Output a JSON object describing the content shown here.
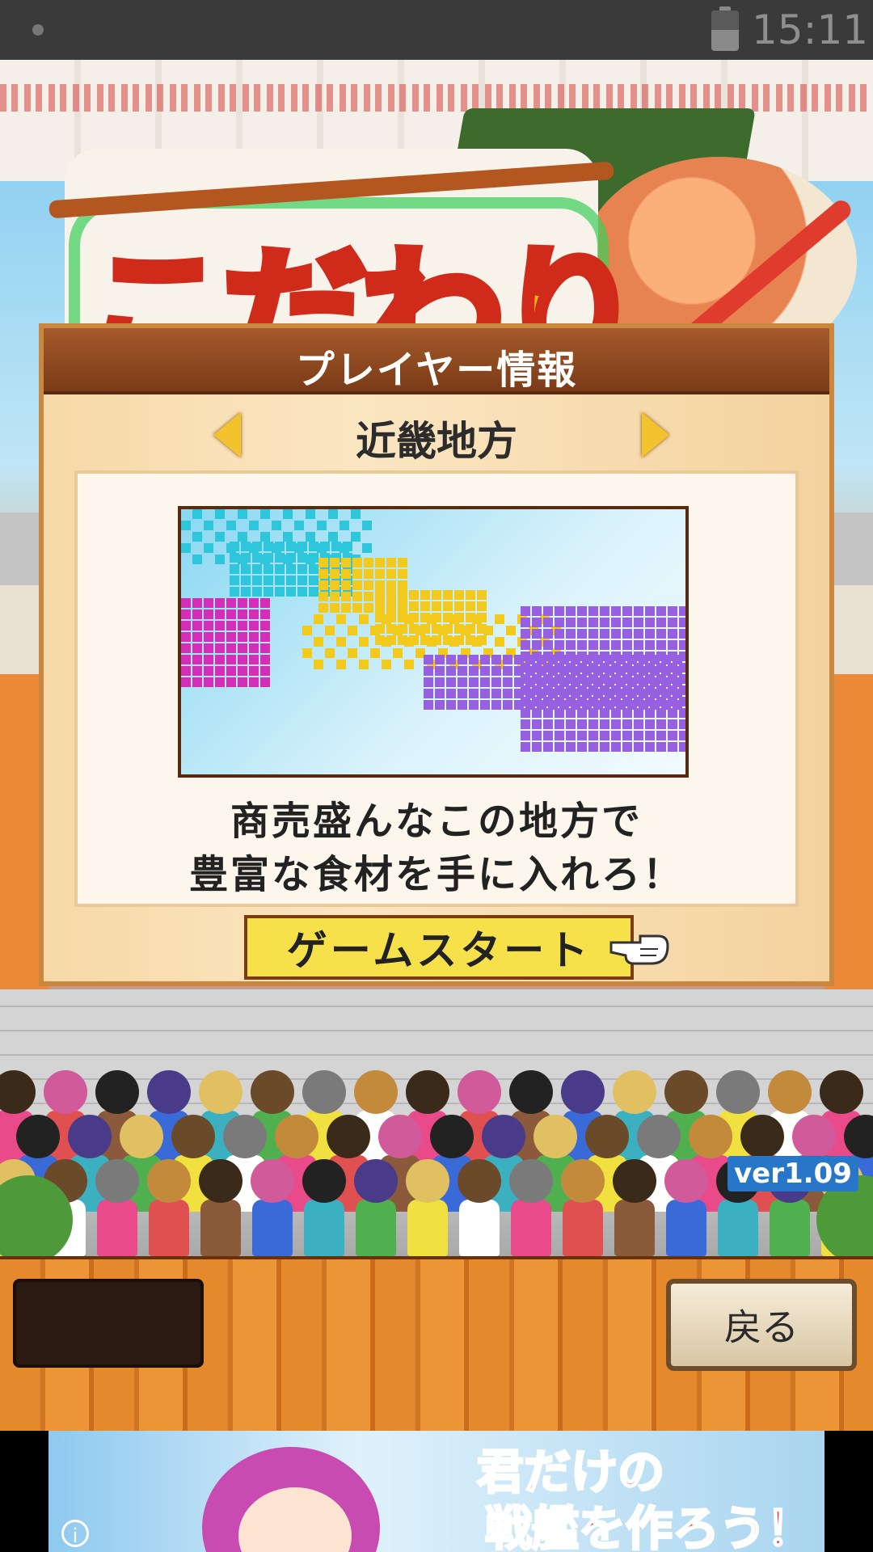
{
  "status_bar": {
    "time": "15:11"
  },
  "title_logo": "こだわり",
  "dialog": {
    "title": "プレイヤー情報",
    "region_name": "近畿地方",
    "description_line1": "商売盛んなこの地方で",
    "description_line2": "豊富な食材を手に入れろ！",
    "start_button_label": "ゲームスタート"
  },
  "map_colors": {
    "cyan": "#2fc6dc",
    "yellow": "#f2c91d",
    "magenta": "#d42eb8",
    "purple": "#9660e0"
  },
  "version_label": "ver1.09",
  "bottom_bar": {
    "back_button_label": "戻る"
  },
  "ad": {
    "line1": "君だけの",
    "line2": "戦艦を作ろう！"
  }
}
